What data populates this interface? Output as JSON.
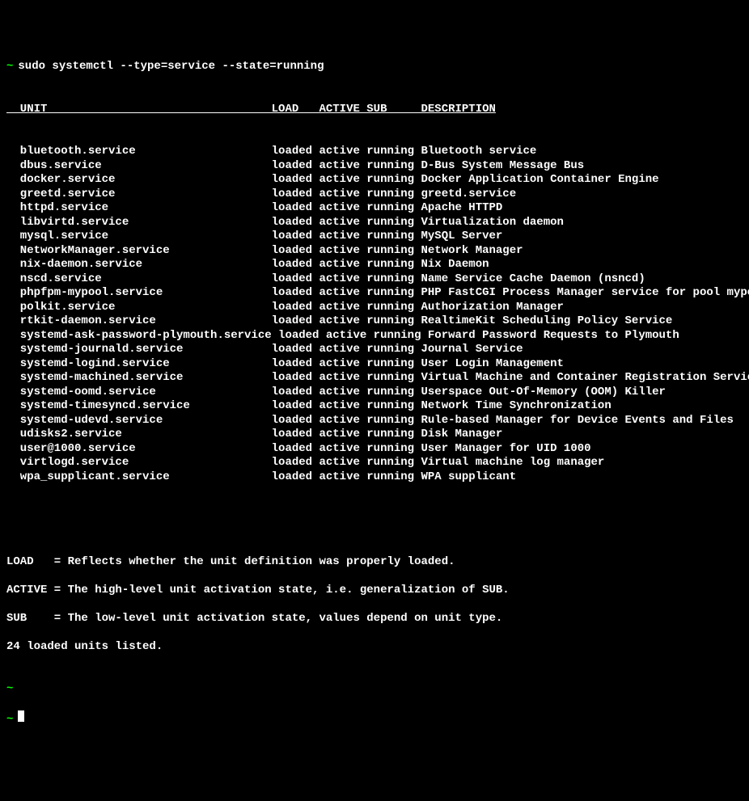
{
  "prompt_marker": "~",
  "command": "sudo systemctl --type=service --state=running",
  "headers": {
    "unit": "UNIT",
    "load": "LOAD",
    "active": "ACTIVE",
    "sub": "SUB",
    "description": "DESCRIPTION"
  },
  "services": [
    {
      "unit": "bluetooth.service",
      "load": "loaded",
      "active": "active",
      "sub": "running",
      "desc": "Bluetooth service"
    },
    {
      "unit": "dbus.service",
      "load": "loaded",
      "active": "active",
      "sub": "running",
      "desc": "D-Bus System Message Bus"
    },
    {
      "unit": "docker.service",
      "load": "loaded",
      "active": "active",
      "sub": "running",
      "desc": "Docker Application Container Engine"
    },
    {
      "unit": "greetd.service",
      "load": "loaded",
      "active": "active",
      "sub": "running",
      "desc": "greetd.service"
    },
    {
      "unit": "httpd.service",
      "load": "loaded",
      "active": "active",
      "sub": "running",
      "desc": "Apache HTTPD"
    },
    {
      "unit": "libvirtd.service",
      "load": "loaded",
      "active": "active",
      "sub": "running",
      "desc": "Virtualization daemon"
    },
    {
      "unit": "mysql.service",
      "load": "loaded",
      "active": "active",
      "sub": "running",
      "desc": "MySQL Server"
    },
    {
      "unit": "NetworkManager.service",
      "load": "loaded",
      "active": "active",
      "sub": "running",
      "desc": "Network Manager"
    },
    {
      "unit": "nix-daemon.service",
      "load": "loaded",
      "active": "active",
      "sub": "running",
      "desc": "Nix Daemon"
    },
    {
      "unit": "nscd.service",
      "load": "loaded",
      "active": "active",
      "sub": "running",
      "desc": "Name Service Cache Daemon (nsncd)"
    },
    {
      "unit": "phpfpm-mypool.service",
      "load": "loaded",
      "active": "active",
      "sub": "running",
      "desc": "PHP FastCGI Process Manager service for pool mypool"
    },
    {
      "unit": "polkit.service",
      "load": "loaded",
      "active": "active",
      "sub": "running",
      "desc": "Authorization Manager"
    },
    {
      "unit": "rtkit-daemon.service",
      "load": "loaded",
      "active": "active",
      "sub": "running",
      "desc": "RealtimeKit Scheduling Policy Service"
    },
    {
      "unit": "systemd-ask-password-plymouth.service",
      "load": "loaded",
      "active": "active",
      "sub": "running",
      "desc": "Forward Password Requests to Plymouth"
    },
    {
      "unit": "systemd-journald.service",
      "load": "loaded",
      "active": "active",
      "sub": "running",
      "desc": "Journal Service"
    },
    {
      "unit": "systemd-logind.service",
      "load": "loaded",
      "active": "active",
      "sub": "running",
      "desc": "User Login Management"
    },
    {
      "unit": "systemd-machined.service",
      "load": "loaded",
      "active": "active",
      "sub": "running",
      "desc": "Virtual Machine and Container Registration Service"
    },
    {
      "unit": "systemd-oomd.service",
      "load": "loaded",
      "active": "active",
      "sub": "running",
      "desc": "Userspace Out-Of-Memory (OOM) Killer"
    },
    {
      "unit": "systemd-timesyncd.service",
      "load": "loaded",
      "active": "active",
      "sub": "running",
      "desc": "Network Time Synchronization"
    },
    {
      "unit": "systemd-udevd.service",
      "load": "loaded",
      "active": "active",
      "sub": "running",
      "desc": "Rule-based Manager for Device Events and Files"
    },
    {
      "unit": "udisks2.service",
      "load": "loaded",
      "active": "active",
      "sub": "running",
      "desc": "Disk Manager"
    },
    {
      "unit": "user@1000.service",
      "load": "loaded",
      "active": "active",
      "sub": "running",
      "desc": "User Manager for UID 1000"
    },
    {
      "unit": "virtlogd.service",
      "load": "loaded",
      "active": "active",
      "sub": "running",
      "desc": "Virtual machine log manager"
    },
    {
      "unit": "wpa_supplicant.service",
      "load": "loaded",
      "active": "active",
      "sub": "running",
      "desc": "WPA supplicant"
    }
  ],
  "footer": {
    "load_desc": "LOAD   = Reflects whether the unit definition was properly loaded.",
    "active_desc": "ACTIVE = The high-level unit activation state, i.e. generalization of SUB.",
    "sub_desc": "SUB    = The low-level unit activation state, values depend on unit type.",
    "count": "24 loaded units listed."
  },
  "cols": {
    "unit": 37,
    "load": 7,
    "active": 7,
    "sub": 8
  }
}
